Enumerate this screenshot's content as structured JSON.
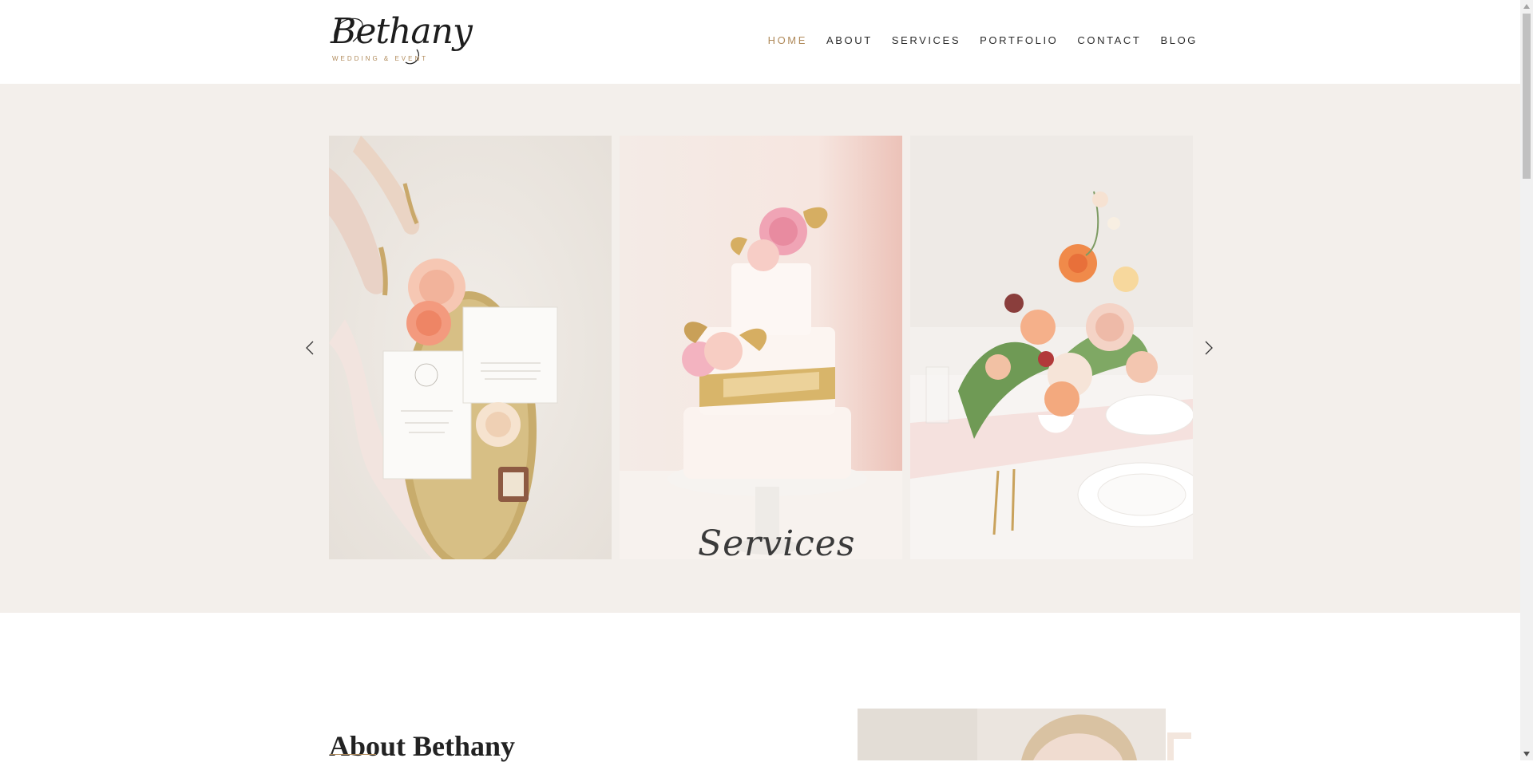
{
  "brand": {
    "logo_script": "Bethany",
    "logo_tagline": "WEDDING & EVENT"
  },
  "nav": {
    "items": [
      {
        "label": "HOME",
        "active": true
      },
      {
        "label": "ABOUT",
        "active": false
      },
      {
        "label": "SERVICES",
        "active": false
      },
      {
        "label": "PORTFOLIO",
        "active": false
      },
      {
        "label": "CONTACT",
        "active": false
      },
      {
        "label": "BLOG",
        "active": false
      }
    ]
  },
  "hero": {
    "slides": [
      {
        "subject": "invitation flat lay with roses, shoes and ring box"
      },
      {
        "subject": "three-tier wedding cake with gold band and flowers"
      },
      {
        "subject": "floral centerpiece on table setting"
      }
    ],
    "overlay_script": "Services",
    "prev_icon": "chevron-left-icon",
    "next_icon": "chevron-right-icon"
  },
  "about": {
    "title": "About Bethany"
  },
  "colors": {
    "accent": "#b08a5a",
    "hero_bg": "#f3efeb",
    "text": "#2b2b2b"
  }
}
